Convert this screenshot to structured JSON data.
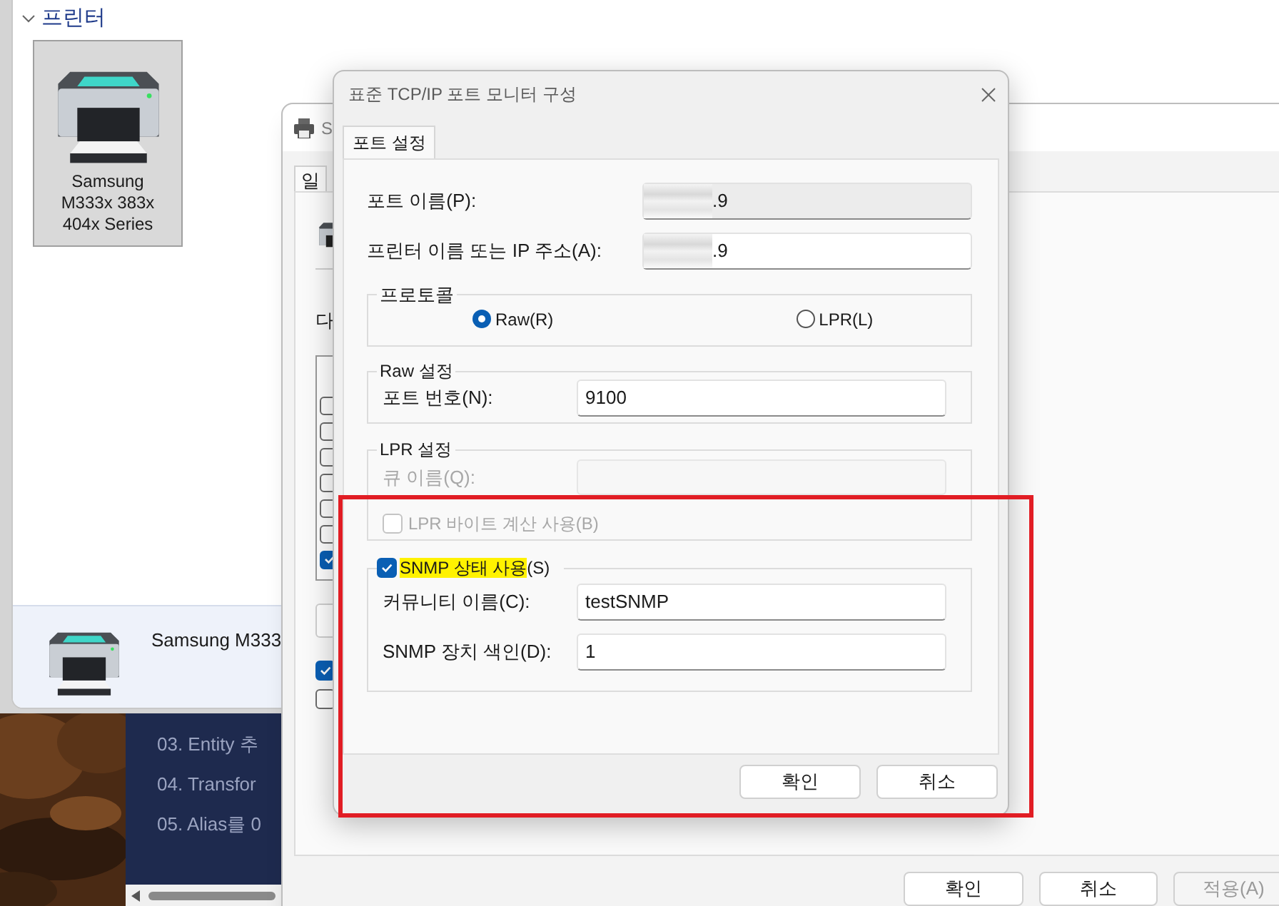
{
  "explorer": {
    "section_title": "프린터",
    "expanded": true,
    "printers": [
      {
        "name": "Samsung M333x 383x 404x Series",
        "selected": true
      }
    ],
    "details": {
      "name": "Samsung M333"
    }
  },
  "background_slide": {
    "items": [
      "03. Entity 추",
      "04. Transfor",
      "05. Alias를 0"
    ]
  },
  "properties_window": {
    "title": "S",
    "tabs": [
      {
        "label": "일",
        "selected": true
      }
    ],
    "label": "다",
    "port_checkboxes": [
      {
        "checked": false
      },
      {
        "checked": false
      },
      {
        "checked": false
      },
      {
        "checked": false
      },
      {
        "checked": false
      },
      {
        "checked": false
      },
      {
        "checked": true
      }
    ],
    "option_checkboxes": [
      {
        "checked": true
      },
      {
        "checked": false
      }
    ],
    "buttons": [
      {
        "label": "확인",
        "disabled": false
      },
      {
        "label": "취소",
        "disabled": false
      },
      {
        "label": "적용(A)",
        "disabled": true
      }
    ]
  },
  "dialog": {
    "title": "표준 TCP/IP 포트 모니터 구성",
    "tabs": [
      {
        "label": "포트 설정",
        "selected": true
      }
    ],
    "port_name": {
      "label": "포트 이름(P):",
      "value": ".9",
      "redacted": true,
      "readonly": true
    },
    "address": {
      "label": "프린터 이름 또는 IP 주소(A):",
      "value": ".9",
      "redacted": true,
      "readonly": false
    },
    "protocol": {
      "title": "프로토콜",
      "options": [
        {
          "label": "Raw(R)",
          "selected": true
        },
        {
          "label": "LPR(L)",
          "selected": false
        }
      ]
    },
    "raw_settings": {
      "title": "Raw 설정",
      "port_number": {
        "label": "포트 번호(N):",
        "value": "9100"
      }
    },
    "lpr_settings": {
      "title": "LPR 설정",
      "queue_name": {
        "label": "큐 이름(Q):",
        "disabled": true
      },
      "byte_counting": {
        "label": "LPR 바이트 계산 사용(B)",
        "checked": false,
        "disabled": true
      }
    },
    "snmp": {
      "label": "SNMP 상태 사용",
      "label_suffix": "(S)",
      "checked": true,
      "highlighted": true,
      "community": {
        "label": "커뮤니티 이름(C):",
        "value": "testSNMP"
      },
      "device_index": {
        "label": "SNMP 장치 색인(D):",
        "value": "1"
      }
    },
    "buttons": [
      {
        "label": "확인"
      },
      {
        "label": "취소"
      }
    ]
  },
  "annotation": {
    "kind": "rectangle",
    "color": "#e11d24"
  }
}
